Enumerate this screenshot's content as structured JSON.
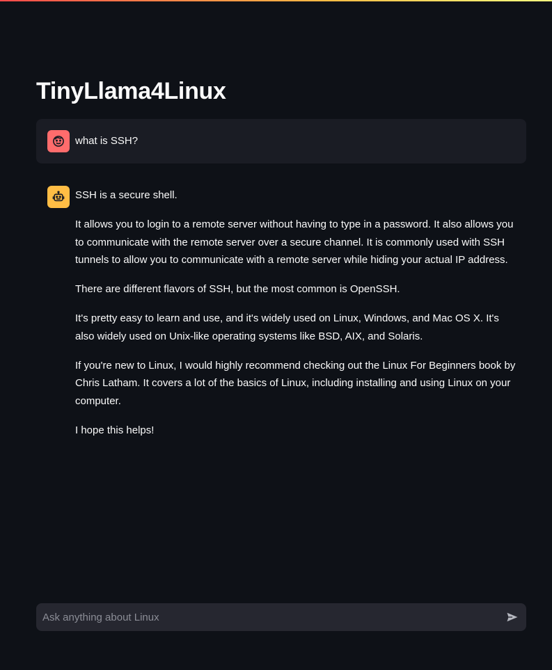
{
  "app": {
    "title": "TinyLlama4Linux"
  },
  "theme": {
    "background": "#0e1117",
    "user_avatar_color": "#ff6c6c",
    "assistant_avatar_color": "#ffbd45",
    "input_background": "#262730"
  },
  "messages": [
    {
      "role": "user",
      "avatar_icon": "smiling-face-icon",
      "paragraphs": [
        "what is SSH?"
      ]
    },
    {
      "role": "assistant",
      "avatar_icon": "robot-icon",
      "paragraphs": [
        "SSH is a secure shell.",
        "It allows you to login to a remote server without having to type in a password. It also allows you to communicate with the remote server over a secure channel. It is commonly used with SSH tunnels to allow you to communicate with a remote server while hiding your actual IP address.",
        "There are different flavors of SSH, but the most common is OpenSSH.",
        "It's pretty easy to learn and use, and it's widely used on Linux, Windows, and Mac OS X. It's also widely used on Unix-like operating systems like BSD, AIX, and Solaris.",
        "If you're new to Linux, I would highly recommend checking out the Linux For Beginners book by Chris Latham. It covers a lot of the basics of Linux, including installing and using Linux on your computer.",
        "I hope this helps!"
      ]
    }
  ],
  "chat_input": {
    "value": "",
    "placeholder": "Ask anything about Linux",
    "send_icon": "send-icon"
  }
}
